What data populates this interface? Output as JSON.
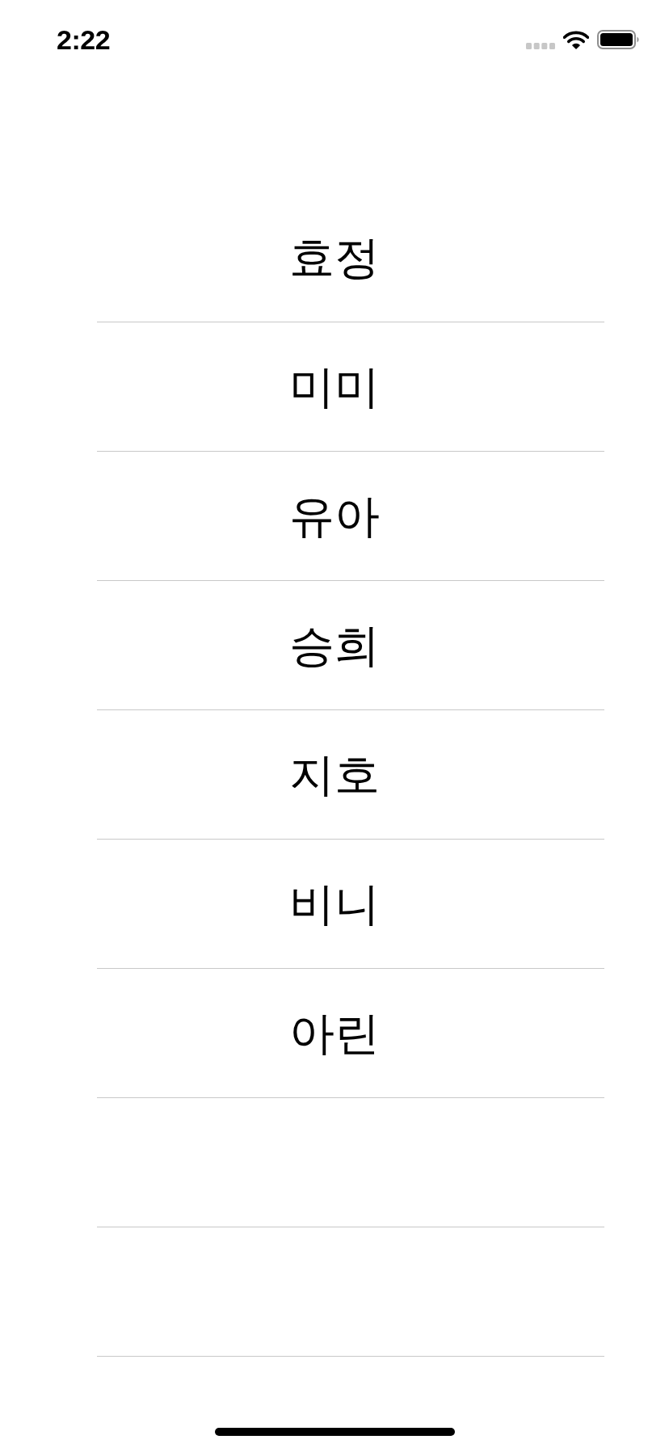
{
  "status_bar": {
    "time": "2:22"
  },
  "list": {
    "rows": [
      {
        "label": "효정"
      },
      {
        "label": "미미"
      },
      {
        "label": "유아"
      },
      {
        "label": "승희"
      },
      {
        "label": "지호"
      },
      {
        "label": "비니"
      },
      {
        "label": "아린"
      }
    ]
  }
}
